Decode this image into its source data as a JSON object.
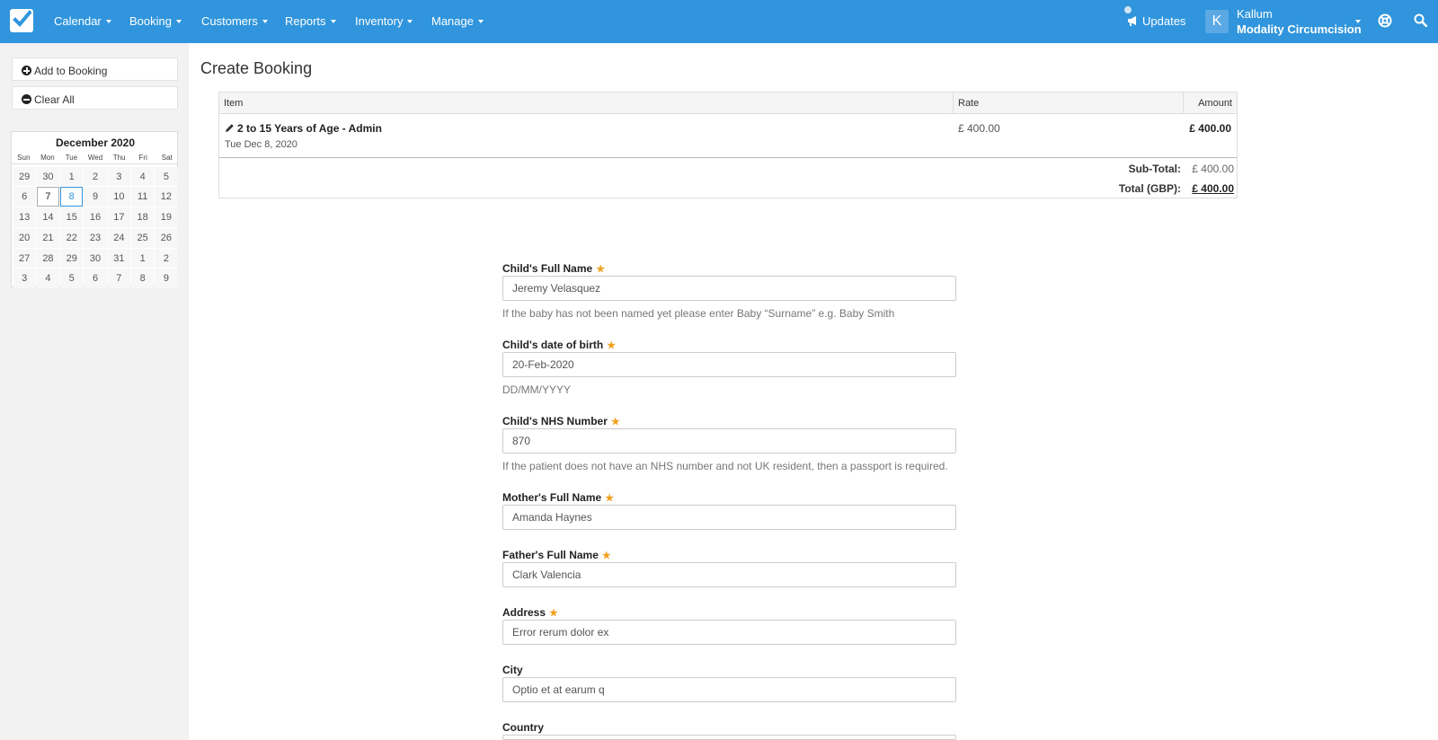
{
  "nav": {
    "items": [
      "Calendar",
      "Booking",
      "Customers",
      "Reports",
      "Inventory",
      "Manage"
    ],
    "updates": "Updates",
    "user_initial": "K",
    "user_name": "Kallum",
    "user_org": "Modality Circumcision"
  },
  "sidebar": {
    "add_label": "Add to Booking",
    "clear_label": "Clear All",
    "calendar": {
      "title": "December 2020",
      "dows": [
        "Sun",
        "Mon",
        "Tue",
        "Wed",
        "Thu",
        "Fri",
        "Sat"
      ],
      "weeks": [
        [
          "29",
          "30",
          "1",
          "2",
          "3",
          "4",
          "5"
        ],
        [
          "6",
          "7",
          "8",
          "9",
          "10",
          "11",
          "12"
        ],
        [
          "13",
          "14",
          "15",
          "16",
          "17",
          "18",
          "19"
        ],
        [
          "20",
          "21",
          "22",
          "23",
          "24",
          "25",
          "26"
        ],
        [
          "27",
          "28",
          "29",
          "30",
          "31",
          "1",
          "2"
        ],
        [
          "3",
          "4",
          "5",
          "6",
          "7",
          "8",
          "9"
        ]
      ],
      "today": "7",
      "selected": "8"
    }
  },
  "main": {
    "title": "Create Booking",
    "table": {
      "headers": {
        "item": "Item",
        "rate": "Rate",
        "amount": "Amount"
      },
      "row": {
        "name": "2 to 15 Years of Age - Admin",
        "date": "Tue Dec 8, 2020",
        "rate": "£ 400.00",
        "amount": "£ 400.00"
      },
      "subtotal_label": "Sub-Total:",
      "subtotal_value": "£ 400.00",
      "total_label": "Total (GBP):",
      "total_value": "£ 400.00"
    },
    "form": {
      "child_name": {
        "label": "Child's Full Name",
        "value": "Jeremy Velasquez",
        "help": "If the baby has not been named yet please enter Baby “Surname” e.g. Baby Smith"
      },
      "child_dob": {
        "label": "Child's date of birth",
        "value": "20-Feb-2020",
        "help": "DD/MM/YYYY"
      },
      "child_nhs": {
        "label": "Child's NHS Number",
        "value": "870",
        "help": "If the patient does not have an NHS number and not UK resident, then a passport is required."
      },
      "mother_name": {
        "label": "Mother's Full Name",
        "value": "Amanda Haynes"
      },
      "father_name": {
        "label": "Father's Full Name",
        "value": "Clark Valencia"
      },
      "address": {
        "label": "Address",
        "value": "Error rerum dolor ex"
      },
      "city": {
        "label": "City",
        "value": "Optio et at earum q"
      },
      "country": {
        "label": "Country"
      }
    }
  }
}
